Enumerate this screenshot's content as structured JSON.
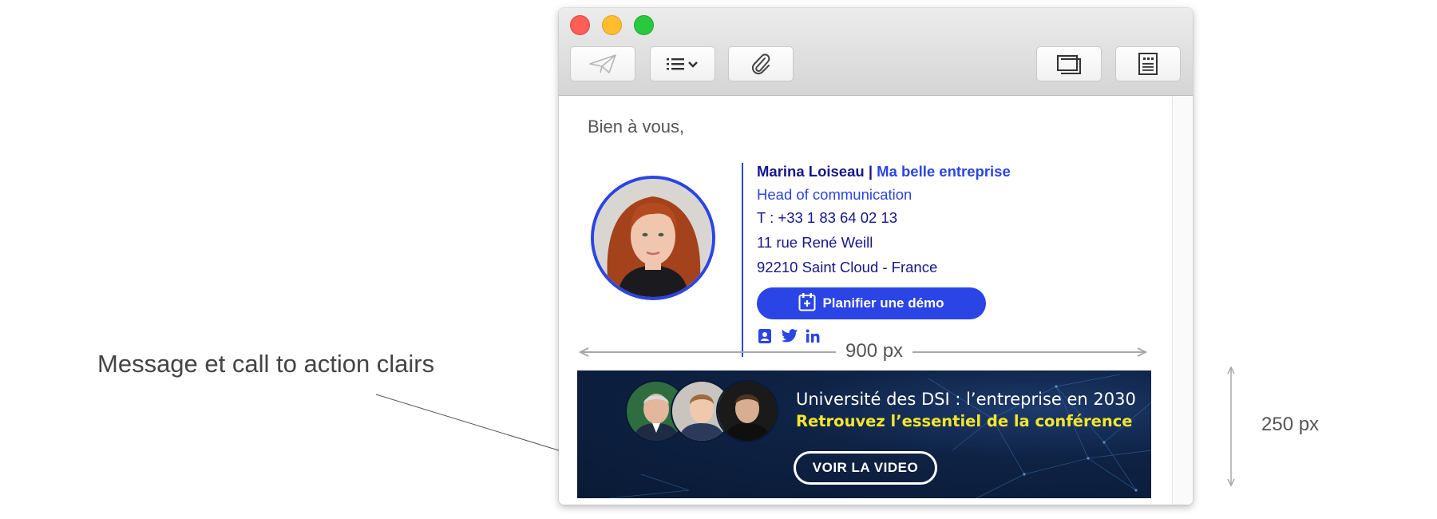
{
  "annotation": {
    "label": "Message et call to action clairs"
  },
  "window": {
    "toolbar": {
      "send_icon": "paper-plane-icon",
      "list_icon": "list-format-icon",
      "attach_icon": "paperclip-icon",
      "window_icon": "windows-icon",
      "doc_icon": "document-icon"
    },
    "greeting": "Bien à vous,",
    "signature": {
      "name": "Marina Loiseau",
      "separator": "|",
      "company": "Ma belle entreprise",
      "title": "Head of communication",
      "phone": "T : +33 1 83 64 02 13",
      "street": "11 rue René Weill",
      "city": "92210 Saint Cloud - France",
      "demo_button": "Planifier une démo",
      "socials": [
        "contact-card-icon",
        "twitter-icon",
        "linkedin-icon"
      ]
    },
    "width_dimension": "900 px",
    "banner": {
      "title": "Université des DSI : l’entreprise en 2030",
      "subtitle": "Retrouvez l’essentiel de la conférence",
      "button": "VOIR LA VIDEO"
    }
  },
  "height_dimension": "250 px",
  "colors": {
    "brand_blue": "#2b44e6",
    "navy_text": "#16168c",
    "banner_bg": "#0a1a36",
    "banner_yellow": "#f5e62a"
  }
}
